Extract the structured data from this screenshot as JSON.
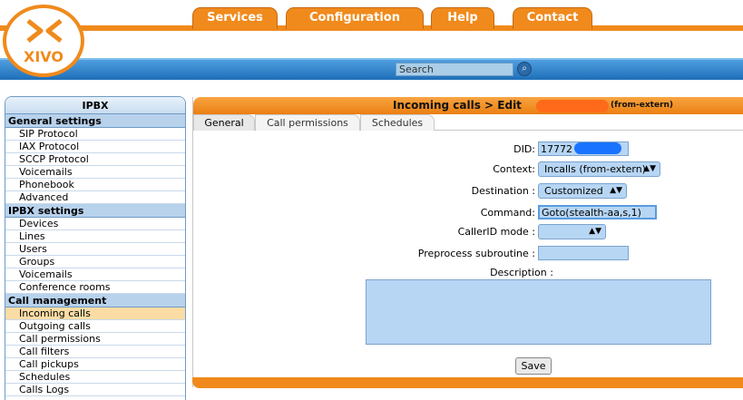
{
  "logo": {
    "text": "XIVO"
  },
  "nav": [
    "Services",
    "Configuration",
    "Help",
    "Contact"
  ],
  "search": {
    "placeholder": "Search",
    "value": "Search"
  },
  "sidebar": {
    "title": "IPBX",
    "sections": [
      {
        "title": "General settings",
        "items": [
          "SIP Protocol",
          "IAX Protocol",
          "SCCP Protocol",
          "Voicemails",
          "Phonebook",
          "Advanced"
        ]
      },
      {
        "title": "IPBX settings",
        "items": [
          "Devices",
          "Lines",
          "Users",
          "Groups",
          "Voicemails",
          "Conference rooms"
        ]
      },
      {
        "title": "Call management",
        "items": [
          "Incoming calls",
          "Outgoing calls",
          "Call permissions",
          "Call filters",
          "Call pickups",
          "Schedules",
          "Calls Logs"
        ]
      }
    ],
    "active_item": "Incoming calls"
  },
  "main": {
    "title": "Incoming calls > Edit",
    "title_suffix": "(from-extern)",
    "tabs": [
      "General",
      "Call permissions",
      "Schedules"
    ],
    "active_tab": "General"
  },
  "form": {
    "did_label": "DID:",
    "did_value": "17772",
    "context_label": "Context:",
    "context_value": "Incalls (from-extern)",
    "destination_label": "Destination :",
    "destination_value": "Customized",
    "command_label": "Command:",
    "command_value": "Goto(stealth-aa,s,1)",
    "callerid_label": "CallerID mode :",
    "callerid_value": "",
    "preprocess_label": "Preprocess subroutine :",
    "preprocess_value": "",
    "description_label": "Description :",
    "save_label": "Save"
  },
  "colors": {
    "accent": "#f08a1c",
    "nav_bar": "#1f6fb8",
    "field": "#b7d6f4",
    "active_item": "#fbdca4"
  }
}
